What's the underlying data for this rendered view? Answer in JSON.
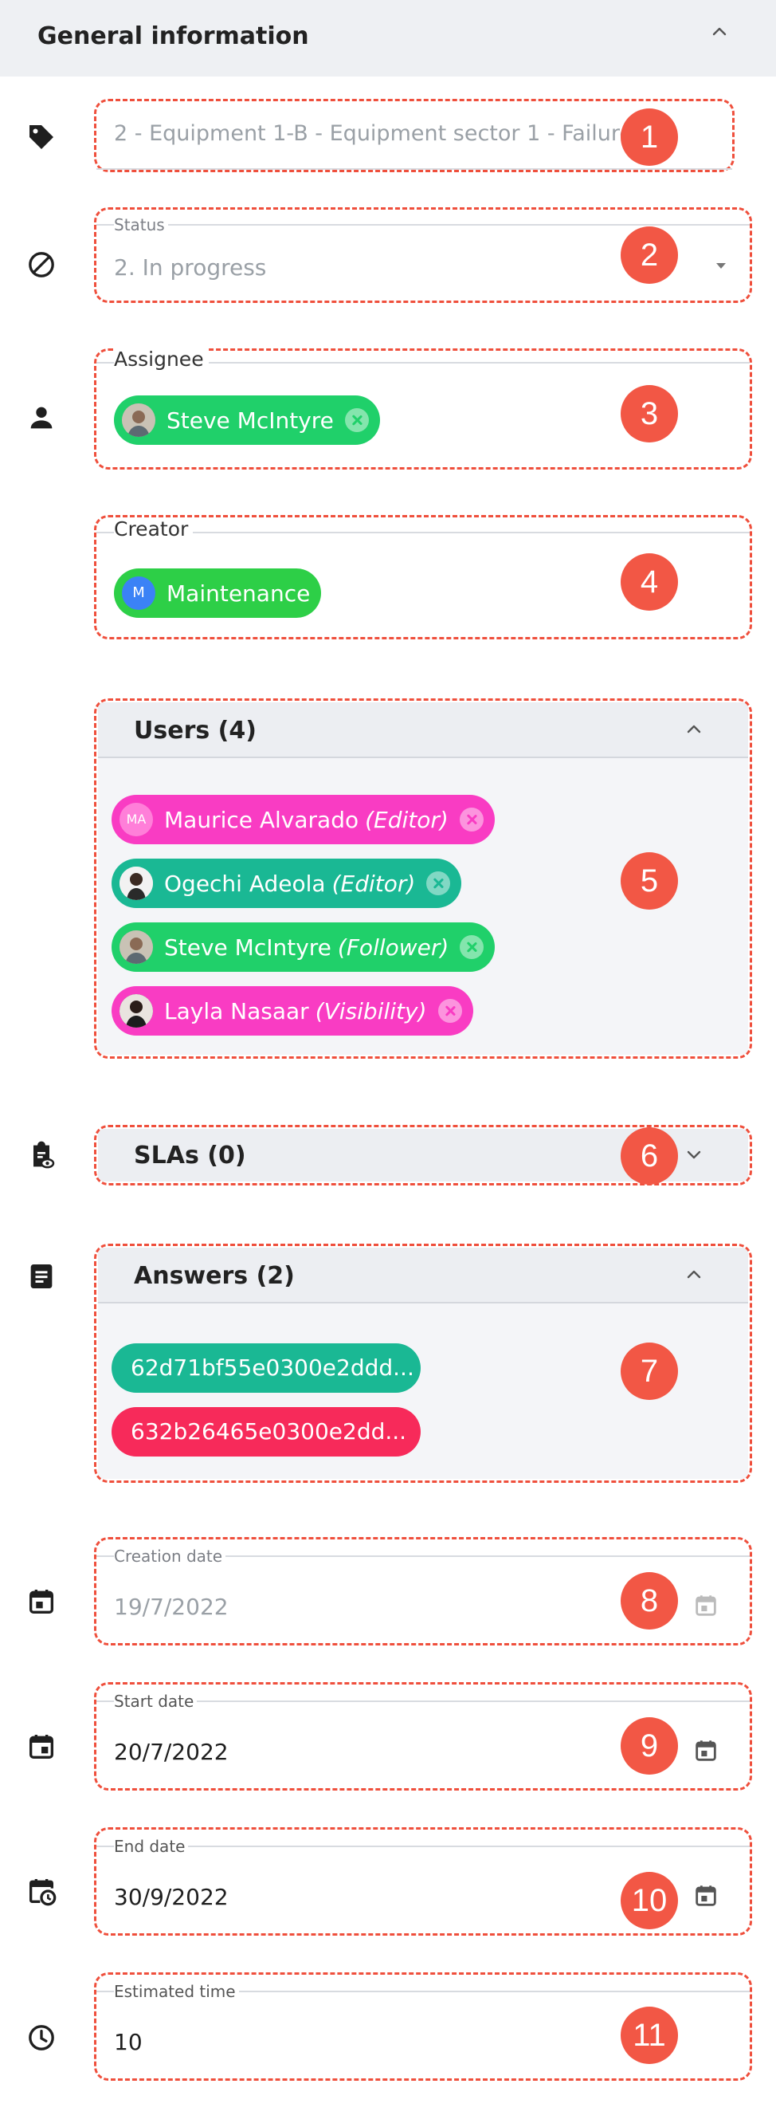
{
  "panel": {
    "title": "General information"
  },
  "title_field": {
    "value": "2 - Equipment 1-B - Equipment sector 1 - Failure D"
  },
  "status": {
    "label": "Status",
    "value": "2. In progress"
  },
  "assignee": {
    "label": "Assignee",
    "chip": {
      "name": "Steve McIntyre",
      "color": "#20d06a"
    }
  },
  "creator": {
    "label": "Creator",
    "chip": {
      "name": "Maintenance",
      "initial": "M",
      "color": "#2dcf47"
    }
  },
  "users": {
    "title": "Users (4)",
    "items": [
      {
        "name": "Maurice Alvarado",
        "role": "(Editor)",
        "initials": "MA",
        "color": "#f93cc3"
      },
      {
        "name": "Ogechi Adeola",
        "role": "(Editor)",
        "color": "#1ab894"
      },
      {
        "name": "Steve McIntyre",
        "role": "(Follower)",
        "color": "#20d06a"
      },
      {
        "name": "Layla Nasaar",
        "role": "(Visibility)",
        "color": "#f93cc3"
      }
    ]
  },
  "slas": {
    "title": "SLAs (0)"
  },
  "answers": {
    "title": "Answers (2)",
    "items": [
      {
        "id": "62d71bf55e0300e2ddd...",
        "color": "#1ab894"
      },
      {
        "id": "632b26465e0300e2dd...",
        "color": "#f72a5a"
      }
    ]
  },
  "creation_date": {
    "label": "Creation date",
    "value": "19/7/2022"
  },
  "start_date": {
    "label": "Start date",
    "value": "20/7/2022"
  },
  "end_date": {
    "label": "End date",
    "value": "30/9/2022"
  },
  "estimated_time": {
    "label": "Estimated time",
    "value": "10"
  },
  "badges": [
    "1",
    "2",
    "3",
    "4",
    "5",
    "6",
    "7",
    "8",
    "9",
    "10",
    "11"
  ],
  "colors": {
    "highlight": "#ef4f3c",
    "badge": "#f25745"
  },
  "icons": {
    "title": "tag-icon",
    "status": "block-icon",
    "assignee": "person-icon",
    "slas": "clipboard-eye-icon",
    "answers": "document-icon",
    "creation_date": "calendar-icon",
    "start_date": "calendar-icon",
    "end_date": "calendar-clock-icon",
    "estimated_time": "clock-icon"
  }
}
